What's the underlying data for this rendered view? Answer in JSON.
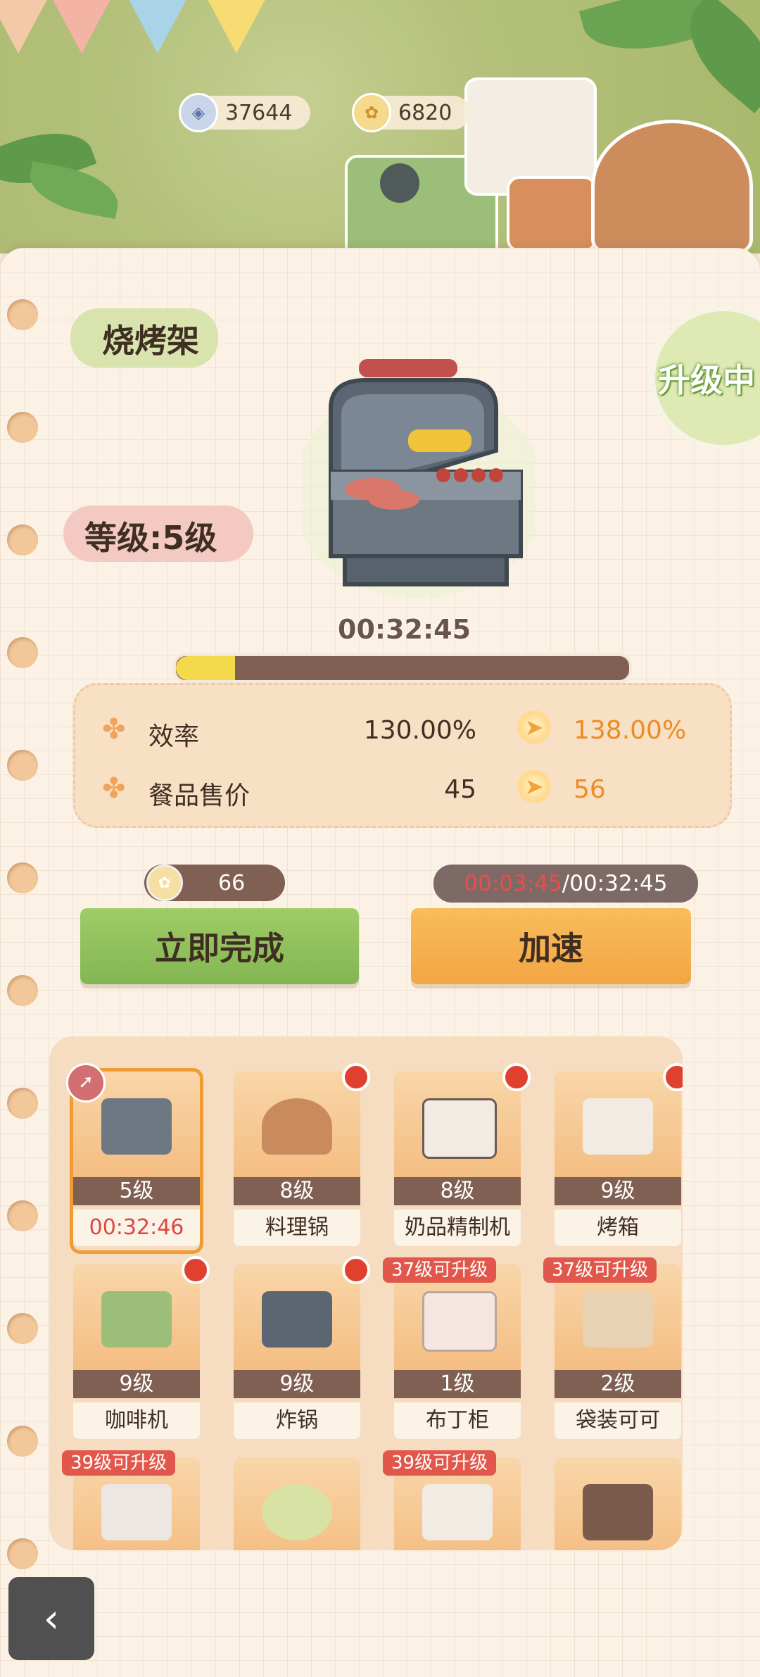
{
  "currencies": [
    {
      "icon": "gem-icon",
      "value": "37644"
    },
    {
      "icon": "coin-icon",
      "value": "6820"
    }
  ],
  "equipment": {
    "title": "烧烤架",
    "level": "等级:5级",
    "status_badge": "升级中",
    "timer": "00:32:45",
    "progress": 0.13
  },
  "stats": [
    {
      "label": "效率",
      "current": "130.00%",
      "next": "138.00%"
    },
    {
      "label": "餐品售价",
      "current": "45",
      "next": "56"
    }
  ],
  "finish_cost": "66",
  "speedup_time": {
    "elapsed": "00:03:45",
    "total": "/00:32:45"
  },
  "buttons": {
    "finish": "立即完成",
    "speedup": "加速"
  },
  "grid": [
    {
      "level": "5级",
      "name": "00:32:46",
      "selected": true
    },
    {
      "level": "8级",
      "name": "料理锅",
      "dot": true
    },
    {
      "level": "8级",
      "name": "奶品精制机",
      "dot": true
    },
    {
      "level": "9级",
      "name": "烤箱",
      "dot": true
    },
    {
      "level": "9级",
      "name": "咖啡机",
      "dot": true
    },
    {
      "level": "9级",
      "name": "炸锅",
      "dot": true
    },
    {
      "level": "1级",
      "name": "布丁柜",
      "lock": "37级可升级"
    },
    {
      "level": "2级",
      "name": "袋装可可",
      "lock": "37级可升级"
    },
    {
      "lock": "39级可升级"
    },
    {},
    {
      "lock": "39级可升级"
    },
    {}
  ],
  "colors": {
    "accent_orange": "#ec8c24",
    "progress_fill": "#f4d94a",
    "finish_green": "#8fbe5a",
    "speed_orange": "#f5ad4a",
    "alert_red": "#e0402e"
  }
}
